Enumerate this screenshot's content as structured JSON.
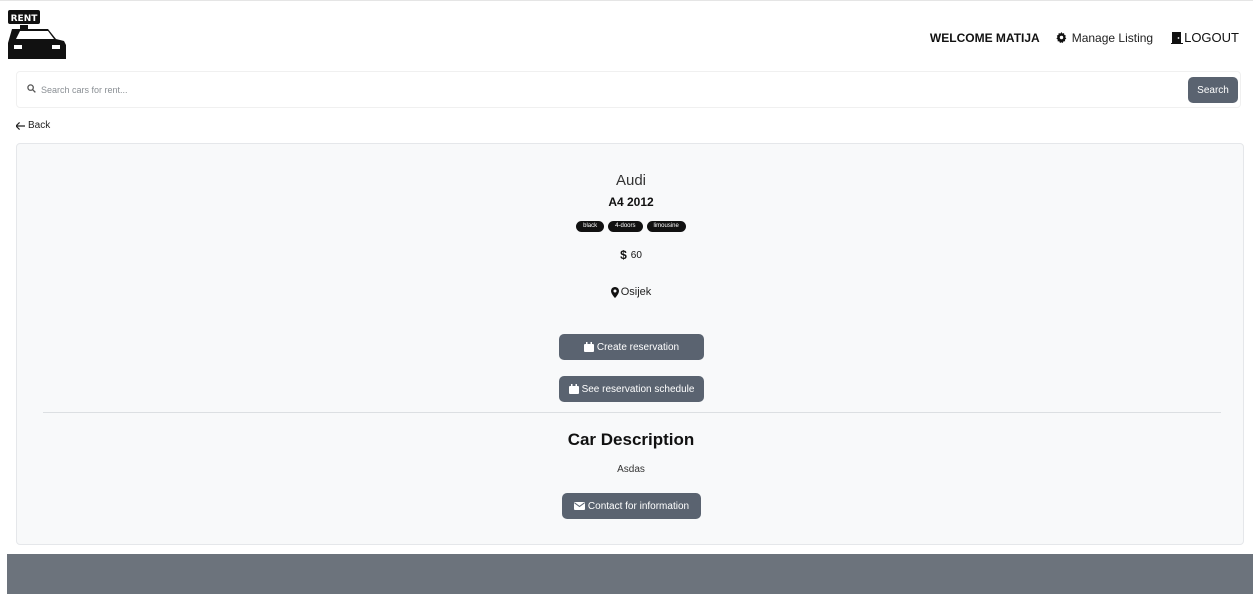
{
  "brand": {
    "logo_text": "RENT"
  },
  "nav": {
    "welcome": "WELCOME MATIJA",
    "manage_listing": "Manage Listing",
    "logout": "LOGOUT"
  },
  "search": {
    "placeholder": "Search cars for rent...",
    "button_label": "Search"
  },
  "back_label": "Back",
  "car": {
    "make": "Audi",
    "model": "A4 2012",
    "tags": [
      "black",
      "4-doors",
      "limousine"
    ],
    "currency": "$",
    "price": "60",
    "location": "Osijek"
  },
  "actions": {
    "create_reservation": "Create reservation",
    "see_schedule": "See reservation schedule",
    "contact": "Contact for information"
  },
  "description": {
    "title": "Car Description",
    "text": "Asdas"
  },
  "colors": {
    "button_bg": "#5a6370",
    "footer_bg": "#6c737c",
    "card_bg": "#f8f9fa"
  },
  "icons": {
    "logo": "car-rent-icon",
    "manage": "gear-icon",
    "logout": "door-icon",
    "search": "search-icon",
    "back": "arrow-left-icon",
    "location": "map-pin-icon",
    "calendar": "calendar-icon",
    "contact": "envelope-icon"
  }
}
